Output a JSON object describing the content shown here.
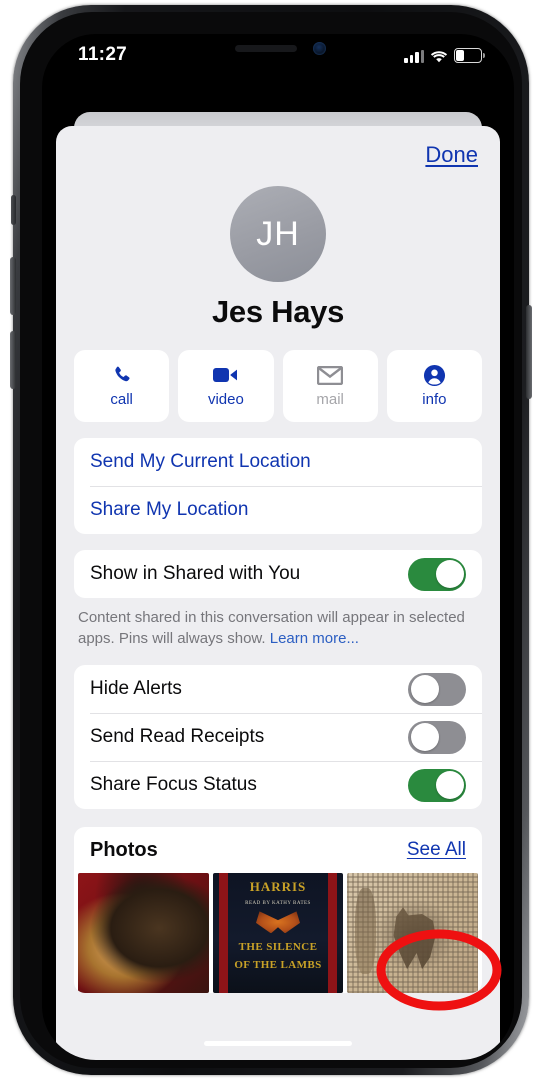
{
  "status_bar": {
    "time": "11:27",
    "signal_icon": "cellular-bars-icon",
    "wifi_icon": "wifi-icon",
    "battery_icon": "battery-icon",
    "battery_level_percent": 30
  },
  "sheet": {
    "done_label": "Done",
    "contact": {
      "initials": "JH",
      "name": "Jes Hays"
    },
    "actions": [
      {
        "label": "call",
        "icon": "phone-icon",
        "enabled": true
      },
      {
        "label": "video",
        "icon": "video-camera-icon",
        "enabled": true
      },
      {
        "label": "mail",
        "icon": "envelope-icon",
        "enabled": false
      },
      {
        "label": "info",
        "icon": "person-circle-icon",
        "enabled": true
      }
    ],
    "location_group": [
      {
        "label": "Send My Current Location"
      },
      {
        "label": "Share My Location"
      }
    ],
    "shared_with_you": {
      "label": "Show in Shared with You",
      "toggle_state": "on",
      "footnote_text": "Content shared in this conversation will appear in selected apps. Pins will always show. ",
      "footnote_link": "Learn more..."
    },
    "settings_group": [
      {
        "label": "Hide Alerts",
        "toggle_state": "off"
      },
      {
        "label": "Send Read Receipts",
        "toggle_state": "off"
      },
      {
        "label": "Share Focus Status",
        "toggle_state": "on"
      }
    ],
    "photos": {
      "title": "Photos",
      "see_all_label": "See All",
      "thumbnails": [
        {
          "name": "photo-dog"
        },
        {
          "name": "photo-book-cover",
          "author": "HARRIS",
          "narrator": "READ BY KATHY BATES",
          "title_line1": "THE SILENCE",
          "title_line2": "OF THE LAMBS"
        },
        {
          "name": "photo-mosaic"
        }
      ]
    }
  },
  "annotation": {
    "shape": "ellipse",
    "color": "#ee1111",
    "target": "See All"
  },
  "colors": {
    "accent_blue": "#1035b0",
    "toggle_on_green": "#2a8a3e",
    "toggle_off_gray": "#8e8e93",
    "sheet_bg": "#eeeef1",
    "card_bg": "#ffffff",
    "footnote_gray": "#76767b",
    "avatar_gray": "#9a9ca4"
  }
}
